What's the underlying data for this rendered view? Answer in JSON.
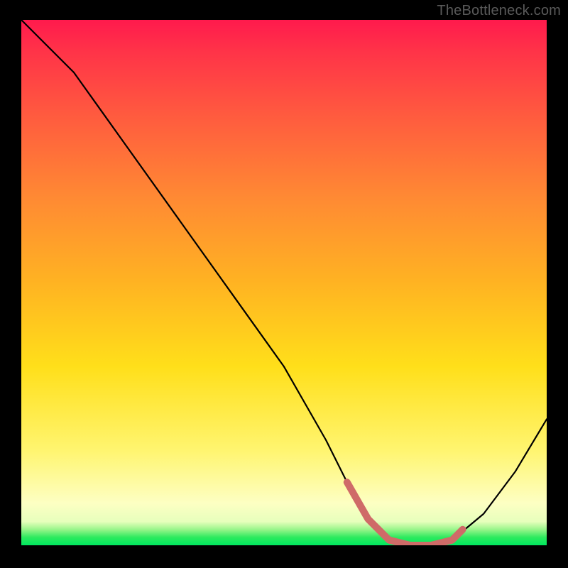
{
  "watermark": "TheBottleneck.com",
  "colors": {
    "curve_stroke": "#000000",
    "highlight_stroke": "#cf6b68",
    "frame_bg": "#000000"
  },
  "chart_data": {
    "type": "line",
    "title": "",
    "xlabel": "",
    "ylabel": "",
    "xlim": [
      0,
      100
    ],
    "ylim": [
      0,
      100
    ],
    "series": [
      {
        "name": "bottleneck-curve",
        "x": [
          0,
          4,
          10,
          20,
          30,
          40,
          50,
          58,
          62,
          66,
          70,
          74,
          78,
          82,
          88,
          94,
          100
        ],
        "y": [
          100,
          96,
          90,
          76,
          62,
          48,
          34,
          20,
          12,
          5,
          1,
          0,
          0,
          1,
          6,
          14,
          24
        ]
      }
    ],
    "highlight": {
      "name": "optimal-range",
      "x": [
        62,
        66,
        70,
        74,
        78,
        82,
        84
      ],
      "y": [
        12,
        5,
        1,
        0,
        0,
        1,
        3
      ]
    }
  }
}
